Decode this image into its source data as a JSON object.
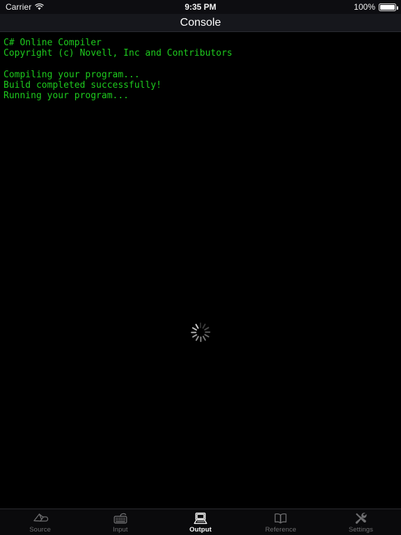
{
  "status_bar": {
    "carrier": "Carrier",
    "wifi_icon": "wifi-icon",
    "time": "9:35 PM",
    "battery_percent": "100%",
    "battery_icon": "battery-full-icon"
  },
  "nav_bar": {
    "title": "Console"
  },
  "console": {
    "text_color": "#1ecb1e",
    "background_color": "#000000",
    "lines": [
      "C# Online Compiler",
      "Copyright (c) Novell, Inc and Contributors",
      "",
      "Compiling your program...",
      "Build completed successfully!",
      "Running your program..."
    ],
    "spinner": {
      "name": "activity-indicator",
      "spokes": 12,
      "color": "#c9c9c9"
    }
  },
  "tab_bar": {
    "active_index": 2,
    "active_color": "#ffffff",
    "inactive_color": "#6e6e70",
    "items": [
      {
        "label": "Source",
        "icon": "pencil-write-icon"
      },
      {
        "label": "Input",
        "icon": "keyboard-icon"
      },
      {
        "label": "Output",
        "icon": "computer-monitor-icon"
      },
      {
        "label": "Reference",
        "icon": "open-book-icon"
      },
      {
        "label": "Settings",
        "icon": "tools-wrench-screwdriver-icon"
      }
    ]
  }
}
